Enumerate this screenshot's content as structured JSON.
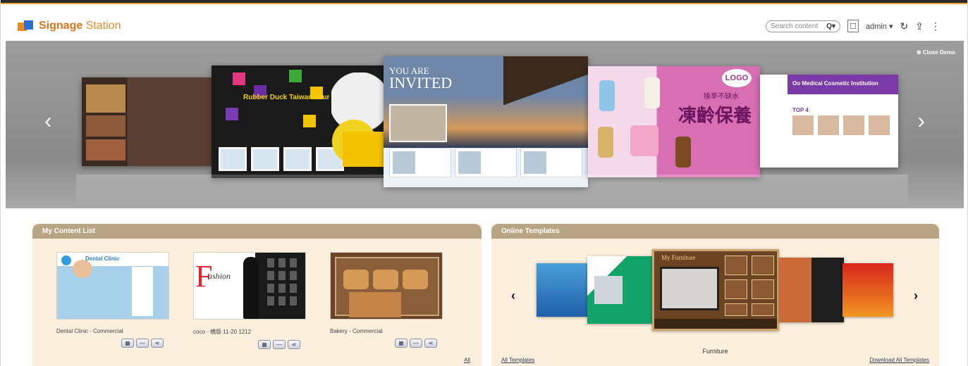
{
  "app": {
    "title_part1": "Signage",
    "title_part2": "Station"
  },
  "header": {
    "search_placeholder": "Search content",
    "search_icon": "Q▾",
    "user_label": "admin",
    "user_caret": "▾",
    "icons": [
      "user-frame-icon",
      "refresh-icon",
      "upload-icon",
      "more-vertical-icon"
    ]
  },
  "hero": {
    "close_demo": "Close Demo",
    "prev": "‹",
    "next": "›",
    "slides": {
      "duck_title": "Rubber Duck Taiwan Tour",
      "invited_small": "YOU ARE",
      "invited_big": "INVITED",
      "logo": "LOGO",
      "zh_small": "換季不缺水",
      "zh_big": "凍齡保養",
      "medical_title": "Oo Medical Cosmetic Institution",
      "top4": "TOP 4"
    }
  },
  "my_content": {
    "title": "My Content List",
    "items": [
      {
        "label": "Dental Clinic - Commercial",
        "thumb_text": "Dental Clinic"
      },
      {
        "label": "coco - 横版 11-20 1212",
        "thumb_text_f": "F",
        "thumb_text": "ashion"
      },
      {
        "label": "Bakery - Commercial",
        "thumb_text": ""
      }
    ],
    "action_icons": [
      "schedule-icon",
      "minus-icon",
      "share-icon"
    ],
    "all_link": "All"
  },
  "online_templates": {
    "title": "Online Templates",
    "prev": "‹",
    "next": "›",
    "featured_inner_title": "My Furniture",
    "current_label": "Furniture",
    "all_link": "All Templates",
    "download_link": "Download All Templates"
  },
  "colors": {
    "brand_orange": "#e0731a",
    "panel_header": "#b9a584",
    "panel_bg": "#fcefde",
    "hero_bg": "#9d9d9d"
  }
}
